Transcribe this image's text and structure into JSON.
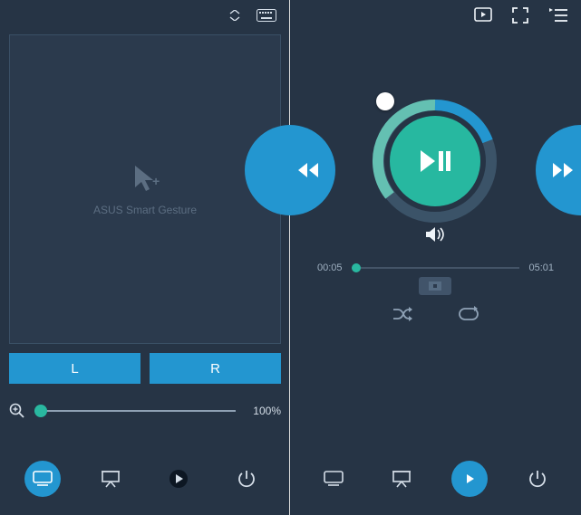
{
  "accent_blue": "#2396d0",
  "accent_teal": "#27b8a0",
  "left": {
    "preview_label": "ASUS Smart Gesture",
    "left_button": "L",
    "right_button": "R",
    "zoom_percent": "100%"
  },
  "right": {
    "elapsed": "00:05",
    "duration": "05:01"
  }
}
